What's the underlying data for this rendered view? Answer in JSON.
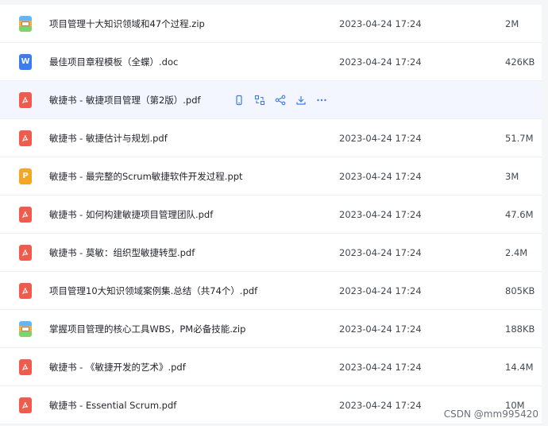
{
  "files": [
    {
      "name": "项目管理十大知识领域和47个过程.zip",
      "date": "2023-04-24 17:24",
      "size": "2M",
      "type": "zip"
    },
    {
      "name": "最佳项目章程模板（全蝶）.doc",
      "date": "2023-04-24 17:24",
      "size": "426KB",
      "type": "doc",
      "type_label": "W"
    },
    {
      "name": "敏捷书 - 敏捷项目管理（第2版）.pdf",
      "date": "",
      "size": "",
      "type": "pdf",
      "hover": true
    },
    {
      "name": "敏捷书 - 敏捷估计与规划.pdf",
      "date": "2023-04-24 17:24",
      "size": "51.7M",
      "type": "pdf"
    },
    {
      "name": "敏捷书 - 最完整的Scrum敏捷软件开发过程.ppt",
      "date": "2023-04-24 17:24",
      "size": "3M",
      "type": "ppt",
      "type_label": "P"
    },
    {
      "name": "敏捷书 - 如何构建敏捷项目管理团队.pdf",
      "date": "2023-04-24 17:24",
      "size": "47.6M",
      "type": "pdf"
    },
    {
      "name": "敏捷书 - 莫敏：组织型敏捷转型.pdf",
      "date": "2023-04-24 17:24",
      "size": "2.4M",
      "type": "pdf"
    },
    {
      "name": "项目管理10大知识领域案例集.总结（共74个）.pdf",
      "date": "2023-04-24 17:24",
      "size": "805KB",
      "type": "pdf"
    },
    {
      "name": "掌握项目管理的核心工具WBS，PM必备技能.zip",
      "date": "2023-04-24 17:24",
      "size": "188KB",
      "type": "zip"
    },
    {
      "name": "敏捷书 - 《敏捷开发的艺术》.pdf",
      "date": "2023-04-24 17:24",
      "size": "14.4M",
      "type": "pdf"
    },
    {
      "name": "敏捷书 - Essential Scrum.pdf",
      "date": "2023-04-24 17:24",
      "size": "10M",
      "type": "pdf"
    }
  ],
  "hover_actions": [
    "phone-icon",
    "transfer-icon",
    "share-icon",
    "download-icon",
    "more-icon"
  ],
  "watermark": "CSDN @mm995420",
  "colors": {
    "pdf": "#ef5b4c",
    "doc": "#3b7cf1",
    "ppt": "#f5a623",
    "accent": "#3b7cf1",
    "hover_row": "#f3f6ff"
  }
}
